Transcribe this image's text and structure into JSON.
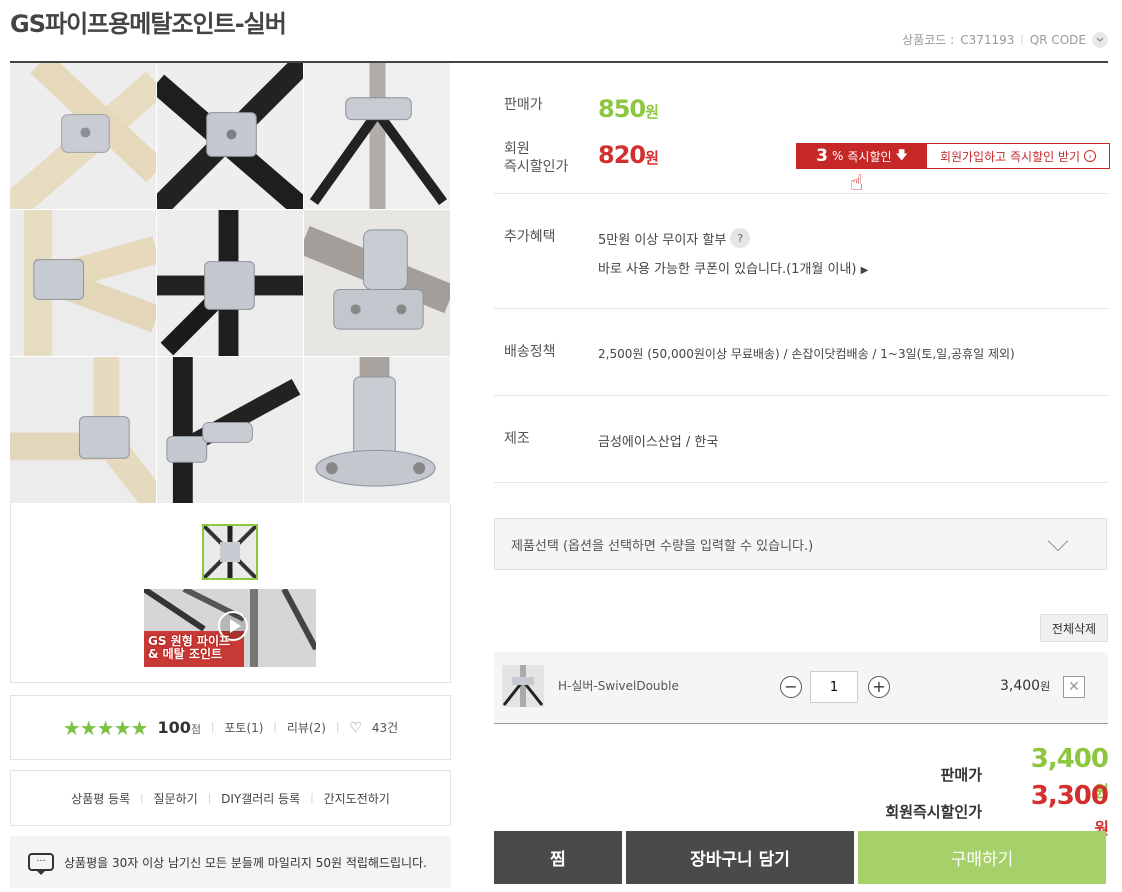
{
  "product": {
    "title": "GS파이프용메탈조인트-실버",
    "code_label": "상품코드 :",
    "code_value": "C371193",
    "qr_label": "QR CODE"
  },
  "gallery": {
    "thumb_text_line1": "GS 원형 파이프",
    "thumb_text_line2": "& 메탈 조인트"
  },
  "review_summary": {
    "stars": "★★★★★",
    "score": "100",
    "score_unit": "점",
    "photo": "포토(1)",
    "review": "리뷰(2)",
    "likes": "43건"
  },
  "actions": [
    "상품평 등록",
    "질문하기",
    "DIY갤러리 등록",
    "간지도전하기"
  ],
  "notice": "상품평을 30자 이상 남기신 모든 분들께 마일리지 50원 적립해드립니다.",
  "pricing": {
    "sale_label": "판매가",
    "sale_price": "850",
    "won": "원",
    "member_label_1": "회원",
    "member_label_2": "즉시할인가",
    "member_price": "820",
    "discount_pct": "3",
    "discount_pct_sign": "%",
    "discount_text": "즉시할인",
    "join_text": "회원가입하고 즉시할인 받기"
  },
  "benefits": {
    "label": "추가혜택",
    "line1": "5만원 이상 무이자 할부",
    "line2": "바로 사용 가능한 쿠폰이 있습니다.(1개월 이내)"
  },
  "shipping": {
    "label": "배송정책",
    "value": "2,500원 (50,000원이상 무료배송) / 손잡이닷컴배송 / 1~3일(토,일,공휴일 제외)"
  },
  "maker": {
    "label": "제조",
    "value": "금성에이스산업 / 한국"
  },
  "option_select": {
    "placeholder": "제품선택 (옵션을 선택하면 수량을 입력할 수 있습니다.)"
  },
  "cart": {
    "delete_all": "전체삭제",
    "item_name": "H-실버-SwivelDouble",
    "quantity": "1",
    "item_price": "3,400",
    "item_price_unit": "원"
  },
  "totals": {
    "sale_label": "판매가",
    "sale_total": "3,400",
    "member_label": "회원즉시할인가",
    "member_total": "3,300",
    "won": "원"
  },
  "buttons": {
    "wish": "찜",
    "cart": "장바구니 담기",
    "buy": "구매하기"
  },
  "colors": {
    "accent_green": "#8dc63f",
    "accent_red": "#d32f2f",
    "dark_button": "#4a4a4a",
    "buy_button": "#a6d16a"
  }
}
